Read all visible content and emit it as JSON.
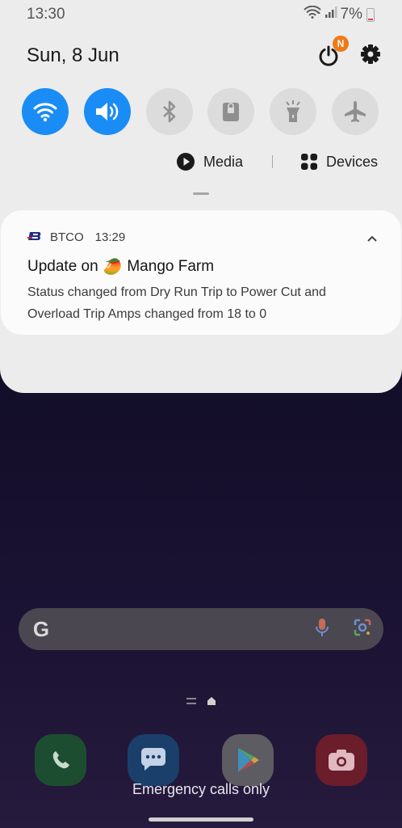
{
  "status_bar": {
    "time": "13:30",
    "battery": "7%"
  },
  "header": {
    "date": "Sun, 8 Jun",
    "notification_badge": "N"
  },
  "quick_settings": {
    "tiles": [
      {
        "id": "wifi",
        "icon": "wifi-icon",
        "active": true
      },
      {
        "id": "sound",
        "icon": "volume-icon",
        "active": true
      },
      {
        "id": "bluetooth",
        "icon": "bluetooth-icon",
        "active": false
      },
      {
        "id": "secure-folder",
        "icon": "lock-folder-icon",
        "active": false
      },
      {
        "id": "torch",
        "icon": "flashlight-icon",
        "active": false
      },
      {
        "id": "airplane",
        "icon": "airplane-icon",
        "active": false
      }
    ],
    "media_label": "Media",
    "devices_label": "Devices"
  },
  "notification": {
    "app_name": "BTCO",
    "time": "13:29",
    "title_prefix": "Update on",
    "title_emoji": "🥭",
    "title_suffix": "Mango Farm",
    "body": "Status changed from Dry Run Trip to Power Cut and Overload Trip Amps changed from 18 to 0"
  },
  "home": {
    "search_logo": "G",
    "dock_apps": [
      "phone-icon",
      "messages-icon",
      "play-store-icon",
      "camera-icon"
    ],
    "emergency_text": "Emergency calls only"
  },
  "colors": {
    "accent": "#1a8cf5",
    "badge": "#f07a18",
    "shade_bg": "#ececec"
  }
}
